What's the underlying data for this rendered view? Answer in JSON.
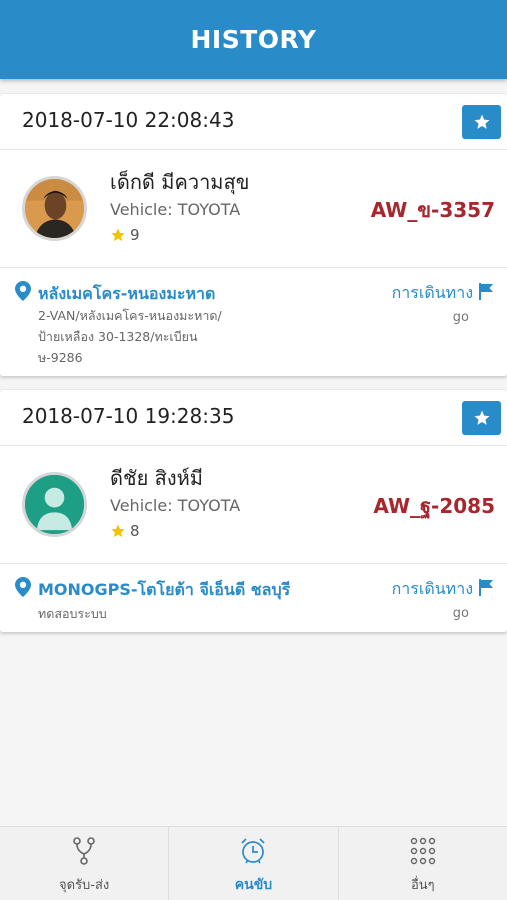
{
  "header": {
    "title": "HISTORY"
  },
  "colors": {
    "primary": "#2a8bc9",
    "plate": "#a8262d",
    "star": "#f3c300"
  },
  "history": [
    {
      "datetime": "2018-07-10 22:08:43",
      "driver_name": "เด็กดี มีความสุข",
      "vehicle": "Vehicle: TOYOTA",
      "rating": "9",
      "plate": "AW_ข-3357",
      "place_name": "หลังเมคโคร-หนองมะหาด",
      "place_desc": "2-VAN/หลังเมคโคร-หนองมะหาด/ป้ายเหลือง 30-1328/ทะเบียน ษ-9286",
      "trip_label": "การเดินทาง",
      "trip_status": "go",
      "avatar": "photo"
    },
    {
      "datetime": "2018-07-10 19:28:35",
      "driver_name": "ดีชัย สิงห์มี",
      "vehicle": "Vehicle: TOYOTA",
      "rating": "8",
      "plate": "AW_ฐ-2085",
      "place_name": "MONOGPS-โตโยต้า จีเอ็นดี ชลบุรี",
      "place_desc": "ทดสอบระบบ",
      "trip_label": "การเดินทาง",
      "trip_status": "go",
      "avatar": "default-user-icon"
    }
  ],
  "tabs": [
    {
      "label": "จุดรับ-ส่ง",
      "icon": "route-icon",
      "active": false
    },
    {
      "label": "คนขับ",
      "icon": "alarm-clock-icon",
      "active": true
    },
    {
      "label": "อื่นๆ",
      "icon": "grid-dots-icon",
      "active": false
    }
  ]
}
